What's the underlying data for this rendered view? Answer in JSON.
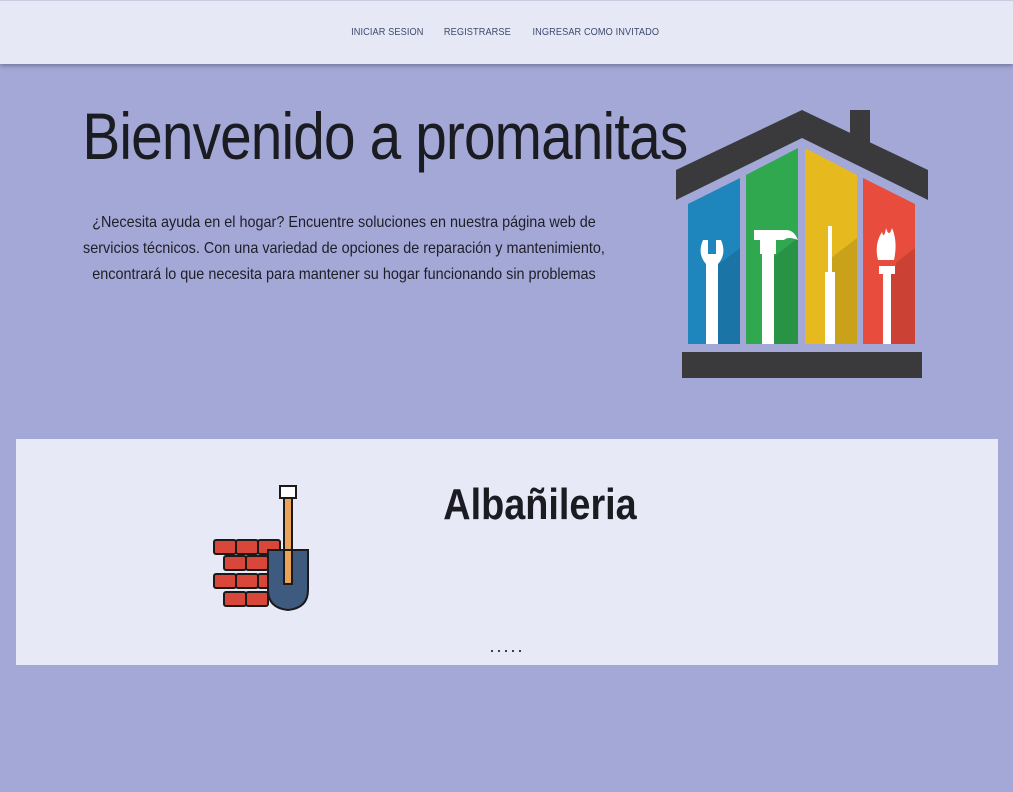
{
  "nav": {
    "login": "INICIAR SESION",
    "register": "REGISTRARSE",
    "guest": "INGRESAR COMO INVITADO"
  },
  "hero": {
    "title": "Bienvenido a promanitas",
    "description": "¿Necesita ayuda en el hogar? Encuentre soluciones en nuestra página web de servicios técnicos. Con una variedad de opciones de reparación y mantenimiento, encontrará lo que necesita para mantener su hogar funcionando sin problemas",
    "logo_icon": "house-tools-icon"
  },
  "service": {
    "title": "Albañileria",
    "icon": "bricks-shovel-icon",
    "more": "....."
  },
  "colors": {
    "background": "#a3a8d6",
    "navbar": "#e7e8f6",
    "card": "#e8e9f7",
    "stripe_blue": "#1f85bd",
    "stripe_green": "#2fa84f",
    "stripe_yellow": "#e6b91e",
    "stripe_red": "#e74c3c",
    "roof": "#3a3a3c"
  }
}
